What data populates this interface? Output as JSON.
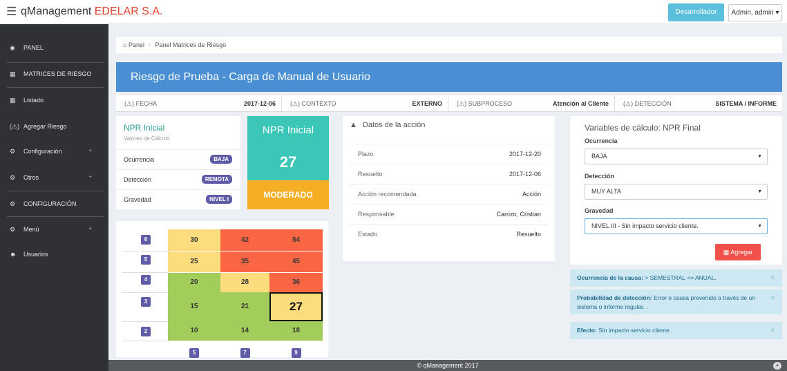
{
  "header": {
    "brand": "qManagement",
    "company": "EDELAR S.A.",
    "dev_button": "Desarrollador",
    "user_menu": "Admin, admin ▾"
  },
  "sidebar": {
    "items": [
      {
        "label": "PANEL",
        "icon": "dashboard-icon"
      },
      {
        "label": "MATRICES DE RIESGO",
        "icon": "grid-icon"
      },
      {
        "label": "Listado",
        "icon": "table-icon"
      },
      {
        "label": "Agregar Riesgo",
        "icon": "warning-icon"
      },
      {
        "label": "Configuración",
        "icon": "cogs-icon"
      },
      {
        "label": "Otros",
        "icon": "cogs-icon"
      },
      {
        "label": "CONFIGURACIÓN",
        "icon": "cogs-icon"
      },
      {
        "label": "Menú",
        "icon": "cogs-icon"
      },
      {
        "label": "Usuarios",
        "icon": "users-icon"
      }
    ],
    "plus": "+"
  },
  "breadcrumb": {
    "home": "Panel",
    "sep": "/",
    "current": "Panel Matrices de Riesgo"
  },
  "title": "Riesgo de Prueba - Carga de Manual de Usuario",
  "info": [
    {
      "label": "FECHA",
      "value": "2017-12-06"
    },
    {
      "label": "CONTEXTO",
      "value": "EXTERNO"
    },
    {
      "label": "SUBPROCESO",
      "value": "Atención al Cliente"
    },
    {
      "label": "DETECCIÓN",
      "value": "SISTEMA / INFORME"
    }
  ],
  "info_icon": "(⚠)",
  "npr_inicial": {
    "title": "NPR Inicial",
    "subtitle": "Valores de Cálculo",
    "rows": [
      {
        "label": "Ocurrencia",
        "badge": "BAJA"
      },
      {
        "label": "Detección",
        "badge": "REMOTA"
      },
      {
        "label": "Gravedad",
        "badge": "NIVEL I"
      }
    ],
    "box_title": "NPR Inicial",
    "box_value": "27",
    "level": "MODERADO",
    "colors": {
      "npr": "#3cc6b8",
      "level": "#f6ae24"
    }
  },
  "matrix": {
    "row_labels": [
      "6",
      "5",
      "4",
      "3",
      "2"
    ],
    "col_labels": [
      "5",
      "7",
      "9"
    ],
    "values": [
      [
        "30",
        "42",
        "54"
      ],
      [
        "25",
        "35",
        "45"
      ],
      [
        "20",
        "28",
        "36"
      ],
      [
        "15",
        "21",
        "27"
      ],
      [
        "10",
        "14",
        "18"
      ]
    ],
    "highlight": "27",
    "colors": {
      "low": "#a3cd5b",
      "mid": "#fcdc7c",
      "high": "#fa6543"
    }
  },
  "datos": {
    "title": "Datos de la acción",
    "rows": [
      {
        "label": "Plazo",
        "value": "2017-12-20"
      },
      {
        "label": "Resuelto",
        "value": "2017-12-06"
      },
      {
        "label": "Acción recomendada",
        "value": "Acción"
      },
      {
        "label": "Responsable",
        "value": "Carrizo, Cristian"
      },
      {
        "label": "Estado",
        "value": "Resuelto"
      }
    ]
  },
  "variables": {
    "title": "Variables de cálculo: NPR Final",
    "ocurrencia_label": "Ocurrencia",
    "ocurrencia_value": "BAJA",
    "deteccion_label": "Detección",
    "deteccion_value": "MUY ALTA",
    "gravedad_label": "Gravedad",
    "gravedad_value": "NIVEL III - Sin impacto servicio cliente.",
    "add_button": "Agregar"
  },
  "alerts": [
    {
      "label": "Ocurrencia de la causa:",
      "text": "> SEMESTRAL <= ANUAL."
    },
    {
      "label": "Probabilidad de detección:",
      "text": "Error o causa prevenido a través de un sistema o informe regular. ."
    },
    {
      "label": "Efecto:",
      "text": "Sin impacto servicio cliente.."
    }
  ],
  "footer": "© qManagement 2017"
}
